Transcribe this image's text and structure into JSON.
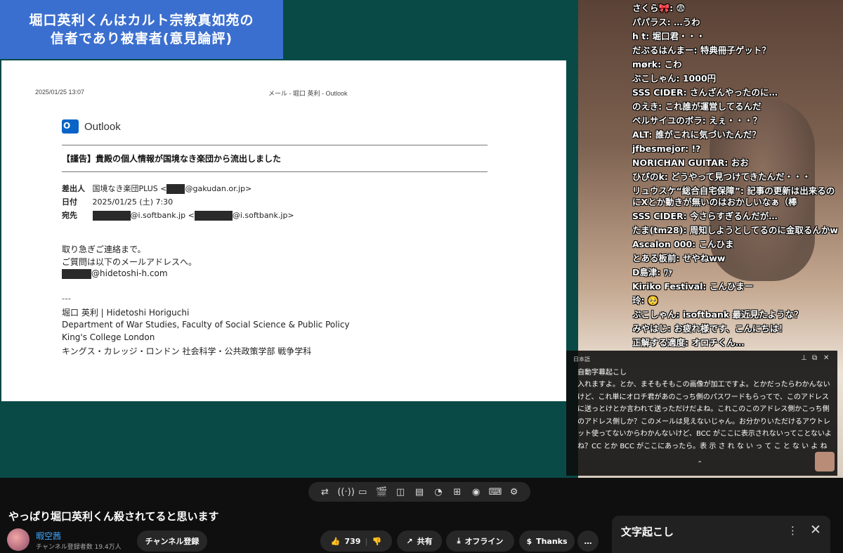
{
  "banner": {
    "line1": "堀口英利くんはカルト宗教真如苑の",
    "line2": "信者であり被害者(意見論評)"
  },
  "email": {
    "datetime": "2025/01/25 13:07",
    "window_title": "メール - 堀口 英利 - Outlook",
    "app": "Outlook",
    "subject": "【謹告】貴殿の個人情報が国境なき楽団から流出しました",
    "from_label": "差出人",
    "from_value": "国境なき楽団PLUS <",
    "from_domain": "@gakudan.or.jp>",
    "date_label": "日付",
    "date_value": "2025/01/25 (土) 7:30",
    "to_label": "宛先",
    "to_a": "@i.softbank.jp <",
    "to_b": "@i.softbank.jp>",
    "body1": "取り急ぎご連絡まで。",
    "body2": "ご質問は以下のメールアドレスへ。",
    "body3": "@hidetoshi-h.com",
    "sig_sep": "---",
    "sig1": "堀口 英利 | Hidetoshi Horiguchi",
    "sig2": "Department of War Studies, Faculty of Social Science & Public Policy",
    "sig3": "King's College London",
    "sig4": "キングス・カレッジ・ロンドン 社会科学・公共政策学部 戦争学科"
  },
  "chat": [
    "さくら🎀: 😨",
    "パパラス: …うわ",
    "h t: 堀口君・・・",
    "だぶるはんまー: 特典冊子ゲット？",
    "mørk: こわ",
    "ぶこしゃん: 1000円",
    "SSS CIDER: さんざんやったのに…",
    "のえき: これ誰が運営してるんだ",
    "ベルサイユのボラ: えぇ・・・？",
    "ALT: 誰がこれに気づいたんだ？",
    "jfbesmejor: !?",
    "NORICHAN GUITAR: おお",
    "ひびのk: どうやって見つけてきたんだ・・・",
    "リュウスケ“総合自宅保障”: 記事の更新は出来るのにXとか動きが無いのはおかしいなぁ（棒",
    "SSS CIDER: 今さらすぎるんだが…",
    "たま(tm28): 周知しようとしてるのに金取るんかw",
    "Ascalon 000: こんひま",
    "とある板前: せやねww",
    "D島津: ﾜｧ",
    "Kiriko Festival: こんひまー",
    "玲: 🥺",
    "ぶこしゃん: isoftbank 最近見たような？",
    "みやはじ: お疲れ様です、こんにちは！",
    "正解する適度: オロチくん…"
  ],
  "captions": {
    "lang": "日本語",
    "title": "自動字幕起こし",
    "text": "入れますよ。とか、まそもそもこの画像が加工ですよ。とかだったらわかんないけど、これ単にオロチ君があのこっち側のパスワードもらってで、このアドレスに送っとけとか言われて送っただけだよね。これこのこのアドレス側かこっち側のアドレス側しか？このメールは見えないじゃん。お分かりいただけるアウトレット使ってないからわかんないけど、BCC がここに表示されないってことないよね？CC とか BCC がここにあったら。表 示 さ れ な い っ て こ と な い よ ね"
  },
  "video": {
    "title": "やっぱり堀口英利くん殺されてると思います",
    "channel": "暇空茜",
    "subscribers": "チャンネル登録者数 19.4万人",
    "subscribe": "チャンネル登録",
    "likes": "739",
    "share": "共有",
    "offline": "オフライン",
    "thanks": "Thanks",
    "more": "…"
  },
  "transcript": {
    "title": "文字起こし"
  }
}
